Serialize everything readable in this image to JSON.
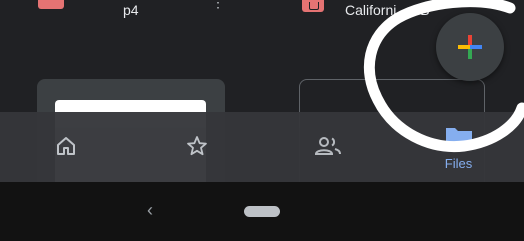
{
  "files": [
    {
      "name": "p4",
      "icon": "pdf-file-icon"
    },
    {
      "name": "Californi",
      "name_suffix": "B",
      "icon": "presentation-file-icon"
    }
  ],
  "bottom_nav": {
    "items": [
      {
        "label": "",
        "icon": "home-icon"
      },
      {
        "label": "",
        "icon": "star-icon"
      },
      {
        "label": "",
        "icon": "shared-people-icon"
      },
      {
        "label": "Files",
        "icon": "folder-icon",
        "active": true
      }
    ]
  },
  "fab": {
    "icon": "plus-icon",
    "colors": [
      "#4285f4",
      "#ea4335",
      "#fbbc04",
      "#34a853"
    ]
  },
  "system_nav": {
    "back_glyph": "‹"
  },
  "colors": {
    "accent": "#8ab4f8",
    "background": "#202124",
    "nav_bg": "#35363a"
  }
}
